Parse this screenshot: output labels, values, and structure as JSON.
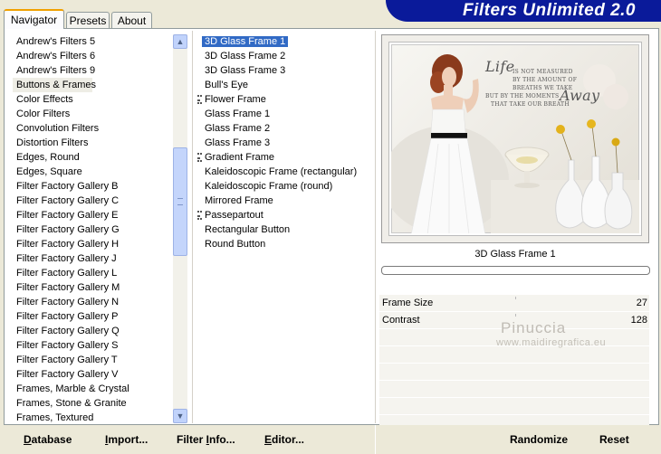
{
  "tabs": [
    {
      "label": "Navigator"
    },
    {
      "label": "Presets"
    },
    {
      "label": "About"
    }
  ],
  "banner": {
    "title": "Filters Unlimited 2.0"
  },
  "categories": {
    "items": [
      "Andrew's Filters 5",
      "Andrew's Filters 6",
      "Andrew's Filters 9",
      "Buttons & Frames",
      "Color Effects",
      "Color Filters",
      "Convolution Filters",
      "Distortion Filters",
      "Edges, Round",
      "Edges, Square",
      "Filter Factory Gallery B",
      "Filter Factory Gallery C",
      "Filter Factory Gallery E",
      "Filter Factory Gallery G",
      "Filter Factory Gallery H",
      "Filter Factory Gallery J",
      "Filter Factory Gallery L",
      "Filter Factory Gallery M",
      "Filter Factory Gallery N",
      "Filter Factory Gallery P",
      "Filter Factory Gallery Q",
      "Filter Factory Gallery S",
      "Filter Factory Gallery T",
      "Filter Factory Gallery V",
      "Frames, Marble & Crystal",
      "Frames, Stone & Granite",
      "Frames, Textured"
    ],
    "selected": "Buttons & Frames"
  },
  "filters": {
    "items": [
      {
        "label": "3D Glass Frame 1",
        "group": false
      },
      {
        "label": "3D Glass Frame 2",
        "group": false
      },
      {
        "label": "3D Glass Frame 3",
        "group": false
      },
      {
        "label": "Bull's Eye",
        "group": false
      },
      {
        "label": "Flower Frame",
        "group": true
      },
      {
        "label": "Glass Frame 1",
        "group": false
      },
      {
        "label": "Glass Frame 2",
        "group": false
      },
      {
        "label": "Glass Frame 3",
        "group": false
      },
      {
        "label": "Gradient Frame",
        "group": true
      },
      {
        "label": "Kaleidoscopic Frame (rectangular)",
        "group": false
      },
      {
        "label": "Kaleidoscopic Frame (round)",
        "group": false
      },
      {
        "label": "Mirrored Frame",
        "group": false
      },
      {
        "label": "Passepartout",
        "group": true
      },
      {
        "label": "Rectangular Button",
        "group": false
      },
      {
        "label": "Round Button",
        "group": false
      }
    ],
    "selected": "3D Glass Frame 1"
  },
  "preview": {
    "caption": "3D Glass Frame 1",
    "poem": {
      "life": "Life",
      "line1": "IS NOT MEASURED",
      "line2": "BY THE AMOUNT OF",
      "line3": "BREATHS WE TAKE",
      "line4": "BUT BY THE MOMENTS",
      "away": "Away",
      "line5": "THAT TAKE OUR BREATH"
    }
  },
  "params": [
    {
      "name": "Frame Size",
      "value": "27"
    },
    {
      "name": "Contrast",
      "value": "128"
    },
    {
      "name": "",
      "value": ""
    },
    {
      "name": "",
      "value": ""
    },
    {
      "name": "",
      "value": ""
    },
    {
      "name": "",
      "value": ""
    },
    {
      "name": "",
      "value": ""
    },
    {
      "name": "",
      "value": ""
    }
  ],
  "watermark": {
    "name": "Pinuccia",
    "url": "www.maidiregrafica.eu"
  },
  "buttons": {
    "database": {
      "mn": "D",
      "rest": "atabase"
    },
    "import": {
      "mn": "I",
      "rest": "mport..."
    },
    "filter_info": {
      "pre": "Filter ",
      "mn": "I",
      "rest": "nfo..."
    },
    "editor": {
      "mn": "E",
      "rest": "ditor..."
    },
    "randomize": "Randomize",
    "reset": "Reset"
  },
  "colors": {
    "banner": "#0a1a9a",
    "selection": "#316ac5",
    "tab_accent": "#f0a000"
  },
  "icons": {
    "scroll_up": "chevron-up-icon",
    "scroll_down": "chevron-down-icon",
    "group": "group-marker-icon"
  }
}
